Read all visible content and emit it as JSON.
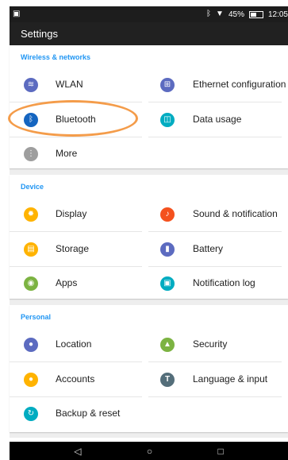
{
  "status_bar": {
    "bluetooth_icon": "bluetooth-icon",
    "wifi_icon": "wifi-icon",
    "battery_percent": "45%",
    "time": "12:05"
  },
  "action_bar": {
    "title": "Settings"
  },
  "sections": {
    "wireless": {
      "header": "Wireless & networks",
      "items": {
        "wlan": {
          "label": "WLAN",
          "icon": "wifi-icon",
          "color": "#5c6bc0"
        },
        "ethernet": {
          "label": "Ethernet configuration",
          "icon": "ethernet-icon",
          "color": "#5c6bc0"
        },
        "bluetooth": {
          "label": "Bluetooth",
          "icon": "bluetooth-icon",
          "color": "#1565c0"
        },
        "data_usage": {
          "label": "Data usage",
          "icon": "data-usage-icon",
          "color": "#00acc1"
        },
        "more": {
          "label": "More",
          "icon": "more-icon",
          "color": "#9e9e9e"
        }
      }
    },
    "device": {
      "header": "Device",
      "items": {
        "display": {
          "label": "Display",
          "icon": "display-icon",
          "color": "#ffb300"
        },
        "sound": {
          "label": "Sound & notification",
          "icon": "bell-icon",
          "color": "#f4511e"
        },
        "storage": {
          "label": "Storage",
          "icon": "storage-icon",
          "color": "#ffb300"
        },
        "battery": {
          "label": "Battery",
          "icon": "battery-icon",
          "color": "#5c6bc0"
        },
        "apps": {
          "label": "Apps",
          "icon": "android-icon",
          "color": "#7cb342"
        },
        "notification_log": {
          "label": "Notification log",
          "icon": "notification-log-icon",
          "color": "#00acc1"
        }
      }
    },
    "personal": {
      "header": "Personal",
      "items": {
        "location": {
          "label": "Location",
          "icon": "location-icon",
          "color": "#5c6bc0"
        },
        "security": {
          "label": "Security",
          "icon": "lock-icon",
          "color": "#7cb342"
        },
        "accounts": {
          "label": "Accounts",
          "icon": "account-icon",
          "color": "#ffb300"
        },
        "language": {
          "label": "Language & input",
          "icon": "language-icon",
          "color": "#546e7a"
        },
        "backup": {
          "label": "Backup & reset",
          "icon": "backup-icon",
          "color": "#00acc1"
        }
      }
    }
  },
  "highlight_color": "#f49c4a",
  "accent_color": "#2196f3",
  "nav_bar": {
    "back_icon": "back-icon",
    "home_icon": "home-icon",
    "recents_icon": "recents-icon"
  }
}
